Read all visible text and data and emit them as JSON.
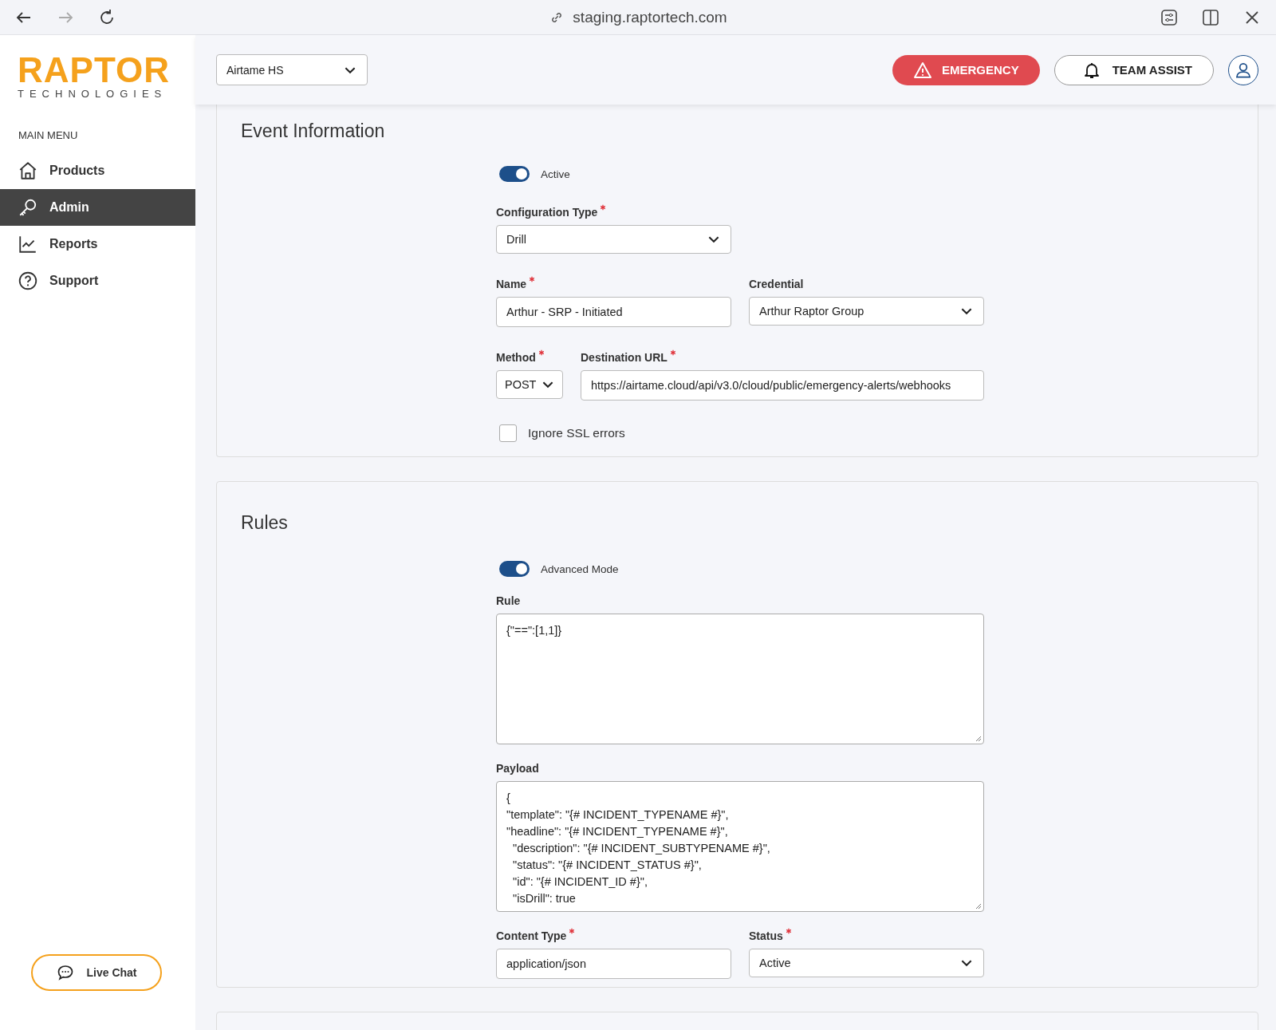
{
  "browser": {
    "url": "staging.raptortech.com"
  },
  "logo": {
    "brand": "RAPTOR",
    "tagline": "TECHNOLOGIES"
  },
  "sidebar": {
    "heading": "MAIN MENU",
    "items": [
      {
        "label": "Products",
        "selected": false
      },
      {
        "label": "Admin",
        "selected": true
      },
      {
        "label": "Reports",
        "selected": false
      },
      {
        "label": "Support",
        "selected": false
      }
    ],
    "live_chat": "Live Chat"
  },
  "header": {
    "school": "Airtame HS",
    "emergency": "EMERGENCY",
    "team_assist": "TEAM ASSIST"
  },
  "sections": [
    {
      "title": "Event Information",
      "rows": [
        [
          {
            "kind": "toggle",
            "label": "Active",
            "on": true
          }
        ],
        [
          {
            "kind": "select",
            "label": "Configuration Type",
            "required": true,
            "value": "Drill"
          }
        ],
        [
          {
            "kind": "input",
            "label": "Name",
            "required": true,
            "value": "Arthur - SRP - Initiated"
          },
          {
            "kind": "select",
            "label": "Credential",
            "required": false,
            "value": "Arthur Raptor Group"
          }
        ],
        [
          {
            "kind": "select",
            "label": "Method",
            "required": true,
            "value": "POST"
          },
          {
            "kind": "input",
            "label": "Destination URL",
            "required": true,
            "value": "https://airtame.cloud/api/v3.0/cloud/public/emergency-alerts/webhooks"
          }
        ],
        [
          {
            "kind": "checkbox",
            "label": "Ignore SSL errors",
            "checked": false
          }
        ]
      ]
    },
    {
      "title": "Rules",
      "rows": [
        [
          {
            "kind": "toggle",
            "label": "Advanced Mode",
            "on": true
          }
        ],
        [
          {
            "kind": "textarea",
            "label": "Rule",
            "required": false,
            "lines": [
              "{\"==\":[1,1]}"
            ]
          }
        ],
        [
          {
            "kind": "textarea",
            "label": "Payload",
            "required": false,
            "lines": [
              "{",
              "\"template\": \"{# INCIDENT_TYPENAME #}\",",
              "\"headline\": \"{# INCIDENT_TYPENAME #}\",",
              "  \"description\": \"{# INCIDENT_SUBTYPENAME #}\",",
              "  \"status\": \"{# INCIDENT_STATUS #}\",",
              "  \"id\": \"{# INCIDENT_ID #}\",",
              "  \"isDrill\": true"
            ]
          }
        ],
        [
          {
            "kind": "input",
            "label": "Content Type",
            "required": true,
            "value": "application/json"
          },
          {
            "kind": "select",
            "label": "Status",
            "required": true,
            "value": "Active"
          }
        ]
      ]
    }
  ]
}
